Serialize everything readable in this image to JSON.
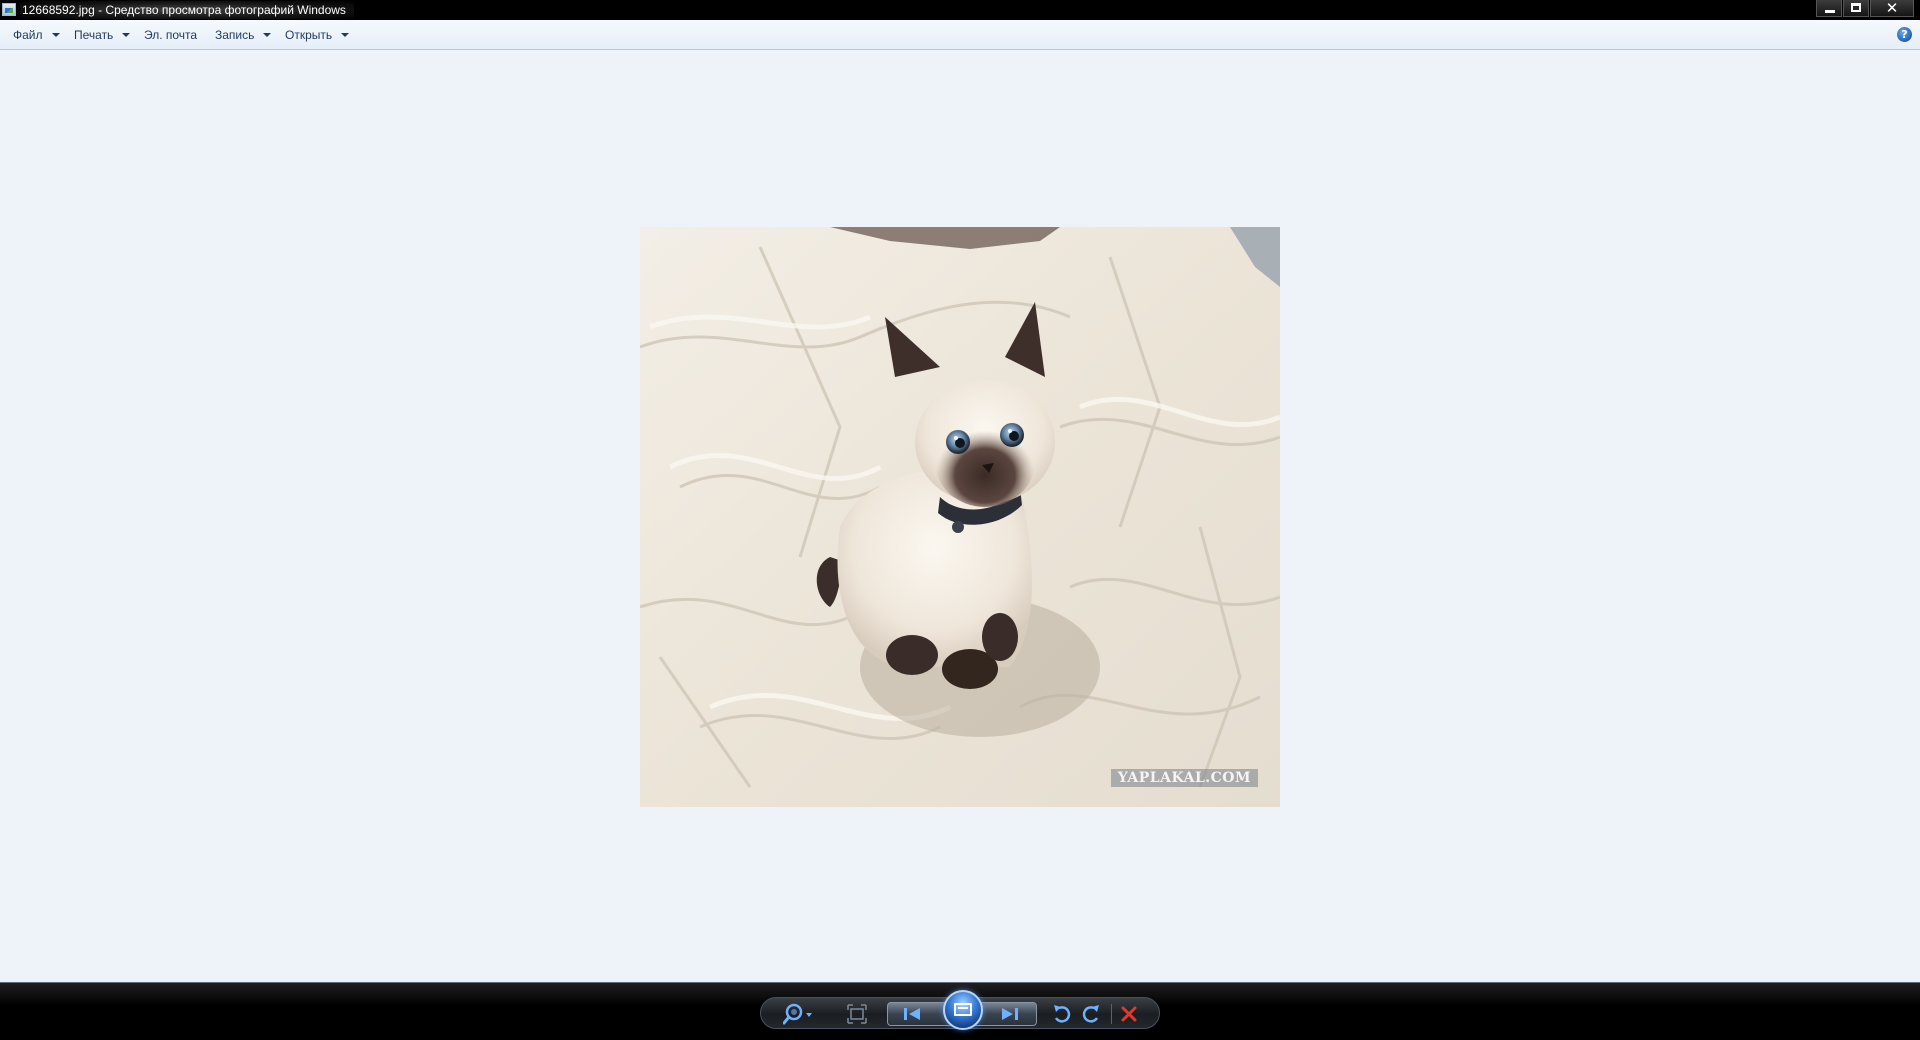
{
  "window": {
    "title": "12668592.jpg - Средство просмотра фотографий Windows",
    "app_icon": "photo-viewer-icon",
    "buttons": {
      "minimize_icon": "minimize-icon",
      "maximize_icon": "restore-icon",
      "close_icon": "close-icon",
      "close_glyph": "✕"
    }
  },
  "menubar": {
    "items": [
      {
        "label": "Файл",
        "has_dropdown": true
      },
      {
        "label": "Печать",
        "has_dropdown": true
      },
      {
        "label": "Эл. почта",
        "has_dropdown": false
      },
      {
        "label": "Запись",
        "has_dropdown": true
      },
      {
        "label": "Открыть",
        "has_dropdown": true
      }
    ],
    "help_glyph": "?"
  },
  "photo": {
    "watermark": "YAPLAKAL.COM"
  },
  "controls": {
    "items": [
      {
        "name": "zoom-icon"
      },
      {
        "name": "actual-size-icon"
      },
      {
        "name": "previous-icon"
      },
      {
        "name": "slideshow-icon"
      },
      {
        "name": "next-icon"
      },
      {
        "name": "rotate-counterclockwise-icon"
      },
      {
        "name": "rotate-clockwise-icon"
      },
      {
        "name": "delete-icon"
      }
    ]
  },
  "colors": {
    "viewer_background": "#eef3fa",
    "menubar_text": "#1e3a5f",
    "accent_blue": "#3b7fd8",
    "delete_red": "#e0392b"
  }
}
